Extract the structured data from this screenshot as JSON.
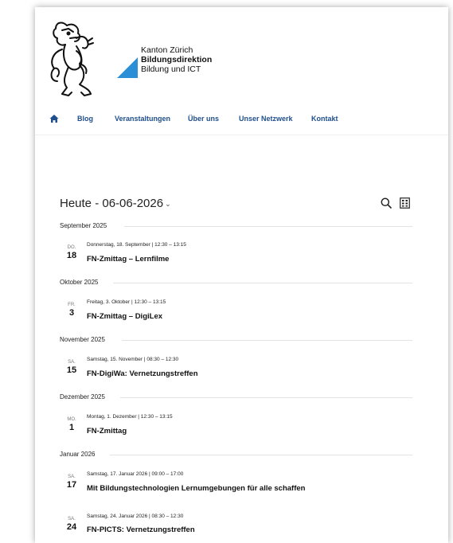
{
  "header": {
    "org_line1": "Kanton Zürich",
    "org_line2": "Bildungsdirektion",
    "org_line3": "Bildung und ICT"
  },
  "nav": {
    "items": [
      "Blog",
      "Veranstaltungen",
      "Über uns",
      "Unser Netzwerk",
      "Kontakt"
    ]
  },
  "calendar": {
    "date_label": "Heute - 06-06-2026",
    "months": [
      {
        "label": "September 2025",
        "events": [
          {
            "dow": "DO.",
            "day": "18",
            "meta": "Donnerstag, 18. September | 12:30 – 13:15",
            "title": "FN-Zmittag – Lernfilme"
          }
        ]
      },
      {
        "label": "Oktober 2025",
        "events": [
          {
            "dow": "FR.",
            "day": "3",
            "meta": "Freitag, 3. Oktober | 12:30 – 13:15",
            "title": "FN-Zmittag – DigiLex"
          }
        ]
      },
      {
        "label": "November 2025",
        "events": [
          {
            "dow": "SA.",
            "day": "15",
            "meta": "Samstag, 15. November | 08:30 – 12:30",
            "title": "FN-DigiWa: Vernetzungstreffen"
          }
        ]
      },
      {
        "label": "Dezember 2025",
        "events": [
          {
            "dow": "MO.",
            "day": "1",
            "meta": "Montag, 1. Dezember | 12:30 – 13:15",
            "title": "FN-Zmittag"
          }
        ]
      },
      {
        "label": "Januar 2026",
        "events": [
          {
            "dow": "SA.",
            "day": "17",
            "meta": "Samstag, 17. Januar 2026 | 09:00 – 17:00",
            "title": "Mit Bildungstechnologien Lernumgebungen für alle schaffen"
          },
          {
            "dow": "SA.",
            "day": "24",
            "meta": "Samstag, 24. Januar 2026 | 08:30 – 12:30",
            "title": "FN-PICTS: Vernetzungstreffen"
          }
        ]
      }
    ]
  },
  "colors": {
    "nav_text": "#1f4f8c",
    "flag_blue": "#2a8fd6"
  }
}
